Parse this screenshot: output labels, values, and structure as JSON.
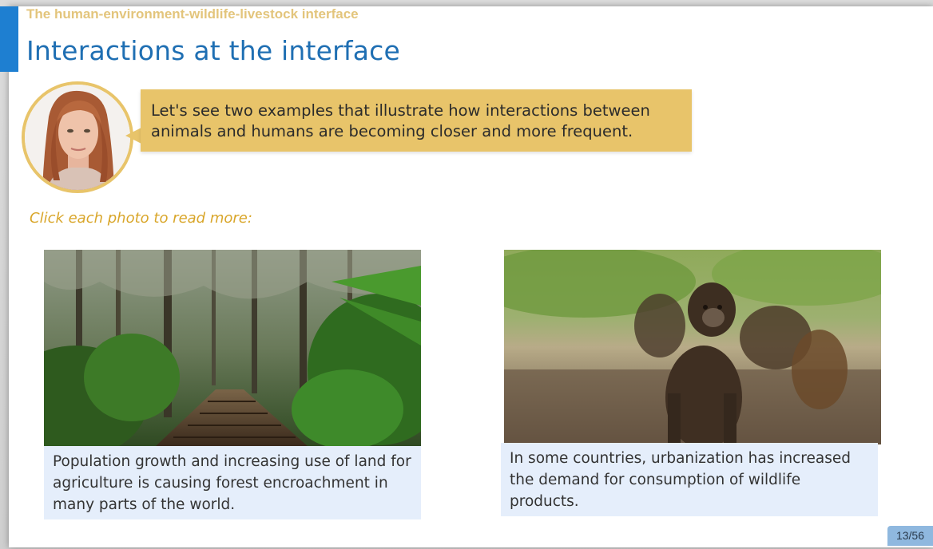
{
  "header": {
    "module_title": "The human-environment-wildlife-livestock interface",
    "page_title": "Interactions at the interface"
  },
  "narrator": {
    "speech": "Let's see two examples that illustrate how interactions between\nanimals and humans are becoming closer and more frequent."
  },
  "instruction": "Click each photo to read more:",
  "cards": [
    {
      "image": "forest-boardwalk-photo",
      "caption": "Population growth and increasing use of land for agriculture is causing forest encroachment in many parts of the world."
    },
    {
      "image": "monkeys-photo",
      "caption": "In some countries, urbanization has increased the demand for consumption of wildlife products."
    }
  ],
  "footer": {
    "page_counter": "13/56"
  },
  "colors": {
    "accent_blue": "#1e7fd1",
    "title_blue": "#1f6fb3",
    "bubble_gold": "#e8c46a",
    "instruction_gold": "#d9a62a",
    "caption_bg": "#e5eefb"
  }
}
